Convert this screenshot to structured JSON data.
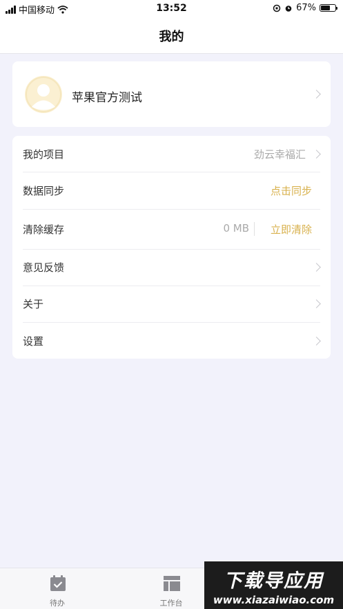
{
  "status_bar": {
    "carrier": "中国移动",
    "time": "13:52",
    "battery_percent": "67%",
    "battery_level": 0.67
  },
  "header": {
    "title": "我的"
  },
  "profile": {
    "name": "苹果官方测试"
  },
  "menu": {
    "project": {
      "label": "我的项目",
      "value": "劲云幸福汇"
    },
    "sync": {
      "label": "数据同步",
      "action": "点击同步"
    },
    "cache": {
      "label": "清除缓存",
      "value": "0 MB",
      "action": "立即清除"
    },
    "feedback": {
      "label": "意见反馈"
    },
    "about": {
      "label": "关于"
    },
    "settings": {
      "label": "设置"
    }
  },
  "tabs": [
    {
      "label": "待办",
      "icon": "calendar-check-icon"
    },
    {
      "label": "工作台",
      "icon": "dashboard-icon"
    }
  ],
  "watermark": {
    "title": "下载导应用",
    "url": "www.xiazaiwiao.com"
  },
  "colors": {
    "accent": "#d8b14d",
    "background": "#f2f2fb",
    "avatar_bg": "#fbf0d2"
  }
}
